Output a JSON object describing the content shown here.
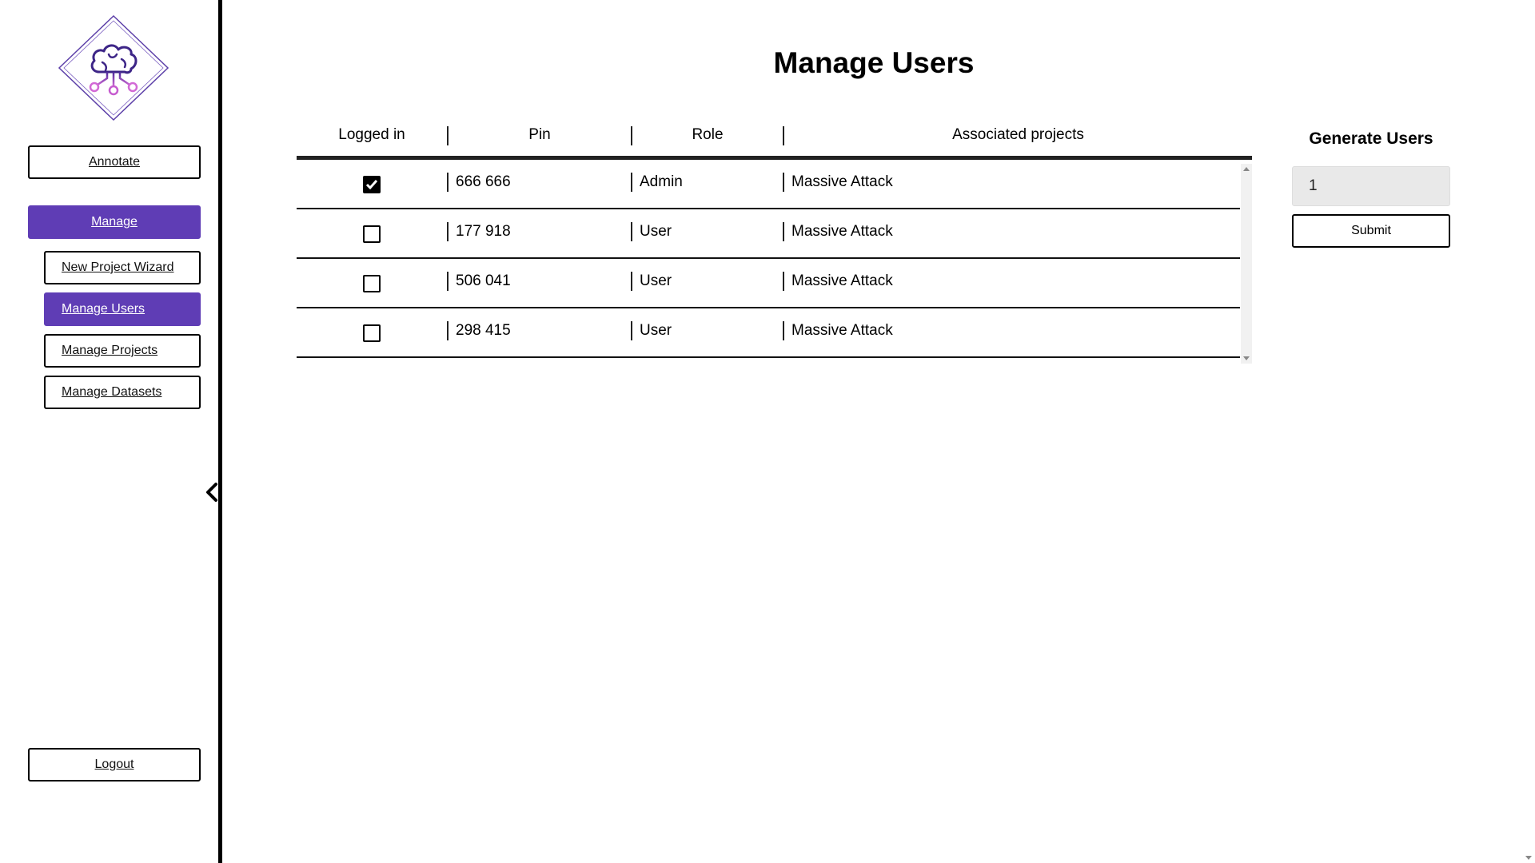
{
  "sidebar": {
    "logo_icon": "brain-circuit-logo",
    "annotate_label": "Annotate",
    "manage_label": "Manage",
    "sub_items": [
      {
        "label": "New Project Wizard"
      },
      {
        "label": "Manage Users"
      },
      {
        "label": "Manage Projects"
      },
      {
        "label": "Manage Datasets"
      }
    ],
    "logout_label": "Logout",
    "collapse_icon": "chevron-left-icon",
    "accent_color": "#5f3db5"
  },
  "main": {
    "title": "Manage Users",
    "table": {
      "columns": [
        "Logged in",
        "Pin",
        "Role",
        "Associated projects"
      ],
      "rows": [
        {
          "logged_in": true,
          "pin": "666 666",
          "role": "Admin",
          "projects": "Massive Attack"
        },
        {
          "logged_in": false,
          "pin": "177 918",
          "role": "User",
          "projects": "Massive Attack"
        },
        {
          "logged_in": false,
          "pin": "506 041",
          "role": "User",
          "projects": "Massive Attack"
        },
        {
          "logged_in": false,
          "pin": "298 415",
          "role": "User",
          "projects": "Massive Attack"
        }
      ]
    }
  },
  "generate": {
    "title": "Generate Users",
    "count_value": "1",
    "submit_label": "Submit"
  }
}
